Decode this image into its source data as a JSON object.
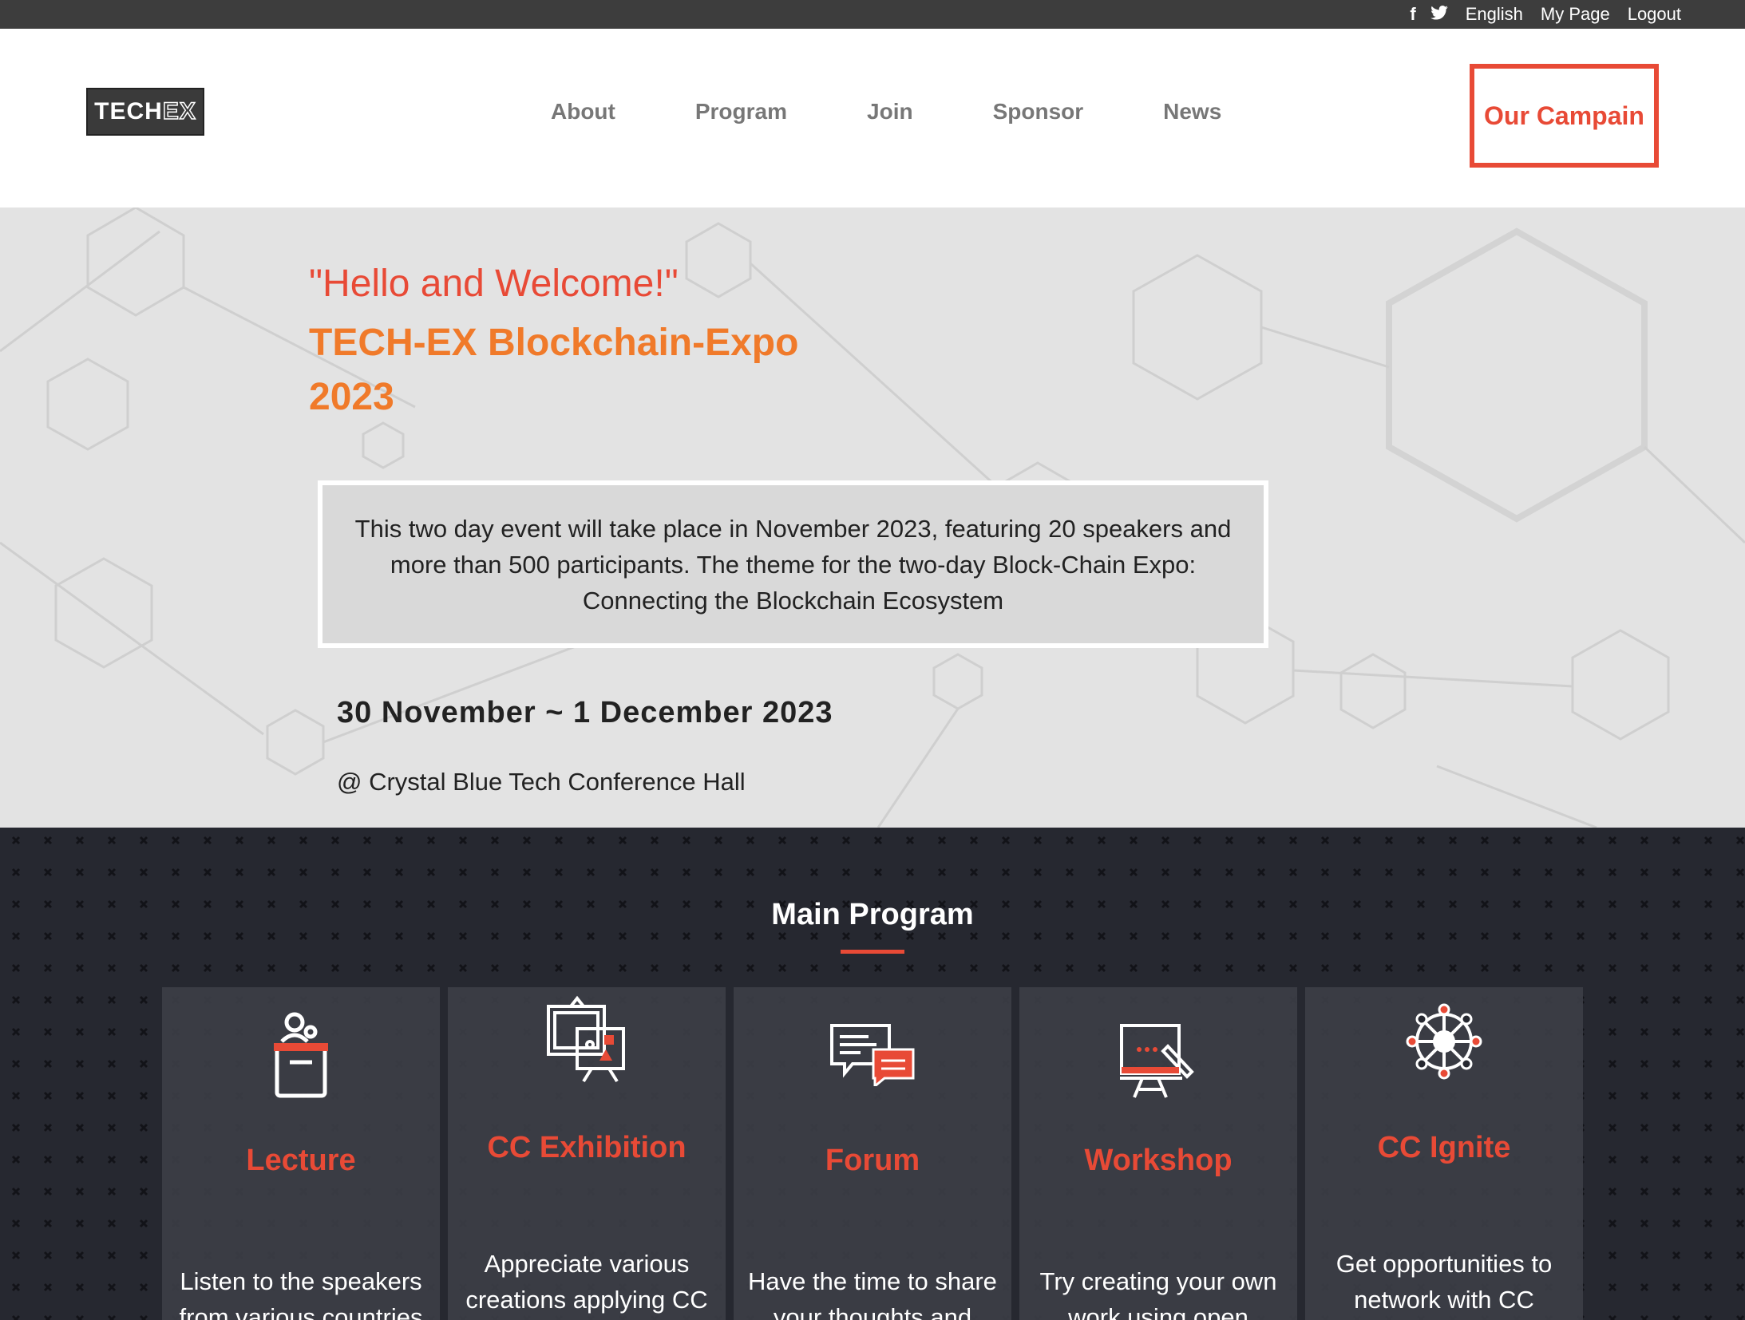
{
  "topbar": {
    "social": [
      "f",
      "t"
    ],
    "language": "English",
    "my_page": "My Page",
    "logout": "Logout"
  },
  "header": {
    "logo_text_1": "TECH",
    "logo_text_2": "EX",
    "nav": [
      "About",
      "Program",
      "Join",
      "Sponsor",
      "News"
    ],
    "campaign_button": "Our Campain"
  },
  "hero": {
    "welcome": "\"Hello and Welcome!\"",
    "title_line1": "TECH-EX Blockchain-Expo",
    "title_line2": "2023",
    "description": "This two day event will take place in November 2023, featuring 20 speakers and more than 500 participants. The theme for the two-day Block-Chain Expo: Connecting the Blockchain Ecosystem",
    "date": "30 November ~ 1 December 2023",
    "venue": "@ Crystal Blue Tech Conference Hall"
  },
  "program": {
    "title": "Main Program",
    "cards": [
      {
        "title": "Lecture",
        "desc": "Listen to the speakers from various countries",
        "icon": "podium-icon"
      },
      {
        "title": "CC Exhibition",
        "desc": "Appreciate various creations applying CC",
        "icon": "exhibition-icon"
      },
      {
        "title": "Forum",
        "desc": "Have the time to share your thoughts and",
        "icon": "chat-bubbles-icon"
      },
      {
        "title": "Workshop",
        "desc": "Try creating your own work using open",
        "icon": "whiteboard-icon"
      },
      {
        "title": "CC Ignite",
        "desc": "Get opportunities to network with CC",
        "icon": "network-icon"
      }
    ]
  },
  "colors": {
    "accent": "#e84a36",
    "title_orange": "#f07a2a",
    "dark_bg": "#262830",
    "topbar": "#3d3d3d"
  }
}
